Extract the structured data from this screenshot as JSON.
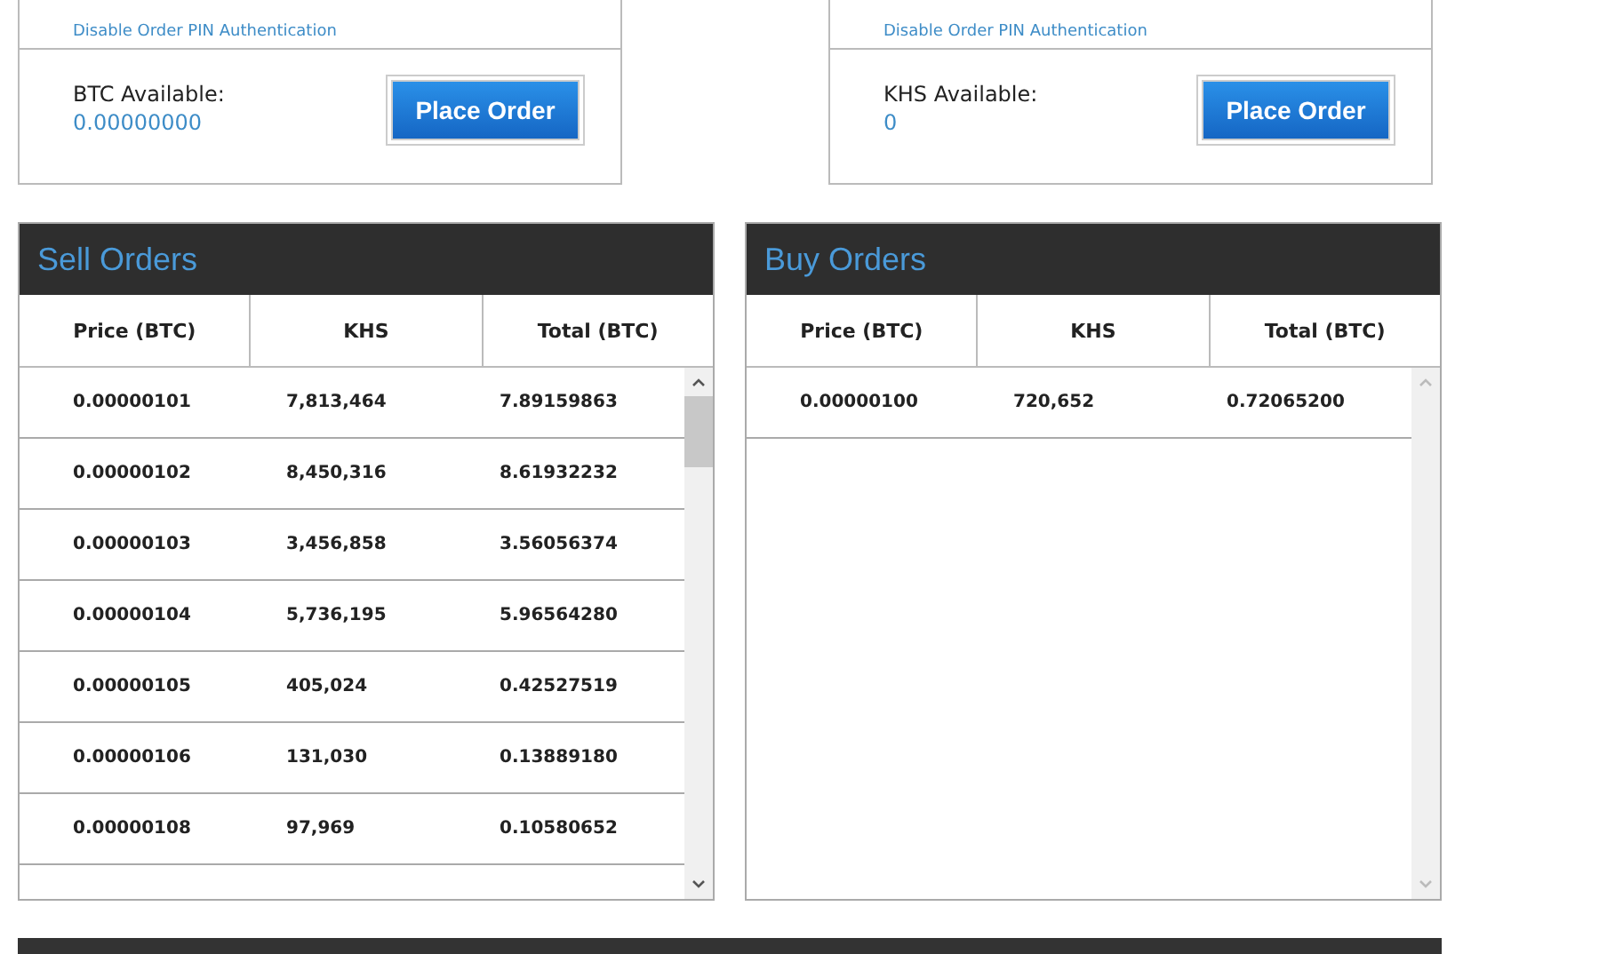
{
  "order_forms": [
    {
      "pin_link": "Disable Order PIN Authentication",
      "available_label": "BTC Available:",
      "available_value": "0.00000000",
      "button": "Place Order"
    },
    {
      "pin_link": "Disable Order PIN Authentication",
      "available_label": "KHS Available:",
      "available_value": "0",
      "button": "Place Order"
    }
  ],
  "order_books": [
    {
      "title": "Sell Orders",
      "columns": [
        "Price (BTC)",
        "KHS",
        "Total (BTC)"
      ],
      "rows": [
        [
          "0.00000101",
          "7,813,464",
          "7.89159863"
        ],
        [
          "0.00000102",
          "8,450,316",
          "8.61932232"
        ],
        [
          "0.00000103",
          "3,456,858",
          "3.56056374"
        ],
        [
          "0.00000104",
          "5,736,195",
          "5.96564280"
        ],
        [
          "0.00000105",
          "405,024",
          "0.42527519"
        ],
        [
          "0.00000106",
          "131,030",
          "0.13889180"
        ],
        [
          "0.00000108",
          "97,969",
          "0.10580652"
        ]
      ],
      "scrollable": true
    },
    {
      "title": "Buy Orders",
      "columns": [
        "Price (BTC)",
        "KHS",
        "Total (BTC)"
      ],
      "rows": [
        [
          "0.00000100",
          "720,652",
          "0.72065200"
        ]
      ],
      "scrollable": false
    }
  ]
}
